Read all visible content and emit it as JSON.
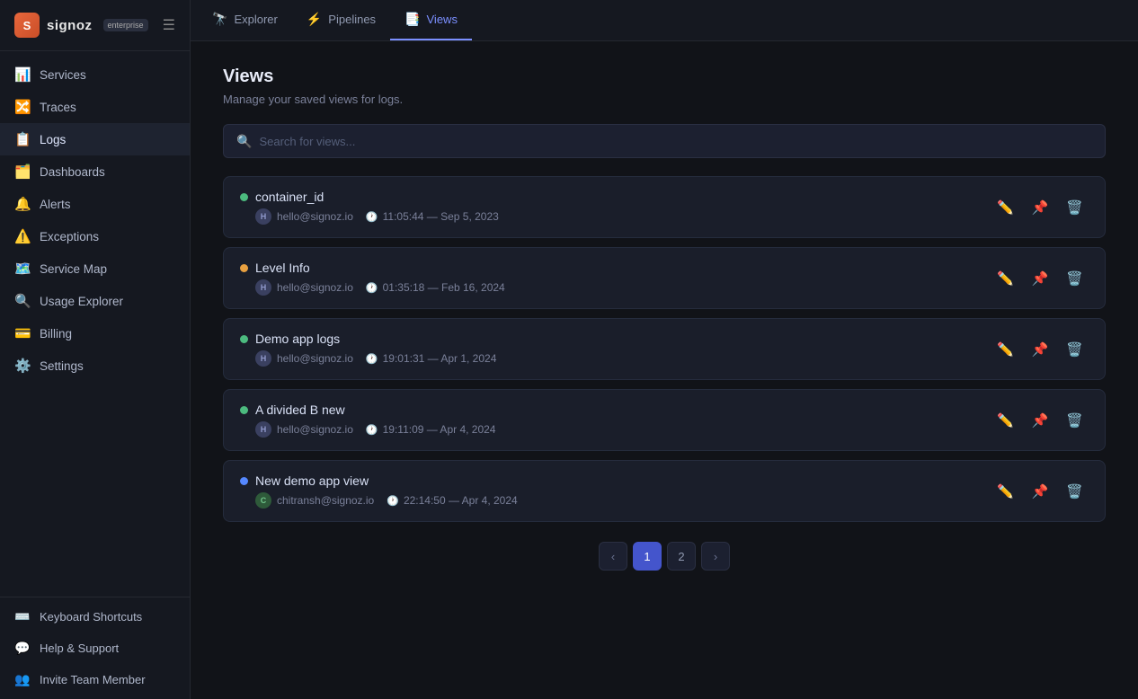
{
  "app": {
    "logo_initials": "S",
    "logo_name": "signoz",
    "logo_badge": "enterprise",
    "hamburger": "≡"
  },
  "sidebar": {
    "nav_items": [
      {
        "id": "services",
        "icon": "📊",
        "label": "Services",
        "active": false
      },
      {
        "id": "traces",
        "icon": "🔀",
        "label": "Traces",
        "active": false
      },
      {
        "id": "logs",
        "icon": "📋",
        "label": "Logs",
        "active": true
      },
      {
        "id": "dashboards",
        "icon": "🗂️",
        "label": "Dashboards",
        "active": false
      },
      {
        "id": "alerts",
        "icon": "🔔",
        "label": "Alerts",
        "active": false
      },
      {
        "id": "exceptions",
        "icon": "⚠️",
        "label": "Exceptions",
        "active": false
      },
      {
        "id": "service-map",
        "icon": "🗺️",
        "label": "Service Map",
        "active": false
      },
      {
        "id": "usage-explorer",
        "icon": "🔍",
        "label": "Usage Explorer",
        "active": false
      },
      {
        "id": "billing",
        "icon": "💳",
        "label": "Billing",
        "active": false
      },
      {
        "id": "settings",
        "icon": "⚙️",
        "label": "Settings",
        "active": false
      }
    ],
    "footer_items": [
      {
        "id": "keyboard-shortcuts",
        "icon": "⌨️",
        "label": "Keyboard Shortcuts"
      },
      {
        "id": "help-support",
        "icon": "💬",
        "label": "Help & Support"
      },
      {
        "id": "invite-team-member",
        "icon": "👥",
        "label": "Invite Team Member"
      }
    ]
  },
  "top_nav": {
    "items": [
      {
        "id": "explorer",
        "icon": "🔭",
        "label": "Explorer",
        "active": false
      },
      {
        "id": "pipelines",
        "icon": "⚡",
        "label": "Pipelines",
        "active": false
      },
      {
        "id": "views",
        "icon": "📑",
        "label": "Views",
        "active": true
      }
    ]
  },
  "main": {
    "title": "Views",
    "subtitle": "Manage your saved views for logs.",
    "search": {
      "placeholder": "Search for views..."
    },
    "views": [
      {
        "id": "container_id",
        "name": "container_id",
        "dot_color": "green",
        "user_initial": "H",
        "user_email": "hello@signoz.io",
        "time": "11:05:44 — Sep 5, 2023"
      },
      {
        "id": "level_info",
        "name": "Level Info",
        "dot_color": "orange",
        "user_initial": "H",
        "user_email": "hello@signoz.io",
        "time": "01:35:18 — Feb 16, 2024"
      },
      {
        "id": "demo_app_logs",
        "name": "Demo app logs",
        "dot_color": "green",
        "user_initial": "H",
        "user_email": "hello@signoz.io",
        "time": "19:01:31 — Apr 1, 2024"
      },
      {
        "id": "a_divided_b_new",
        "name": "A divided B new",
        "dot_color": "green",
        "user_initial": "H",
        "user_email": "hello@signoz.io",
        "time": "19:11:09 — Apr 4, 2024"
      },
      {
        "id": "new_demo_app_view",
        "name": "New demo app view",
        "dot_color": "blue",
        "user_initial": "C",
        "user_email": "chitransh@signoz.io",
        "time": "22:14:50 — Apr 4, 2024",
        "avatar_type": "chitransh"
      }
    ],
    "pagination": {
      "current": 1,
      "total": 2,
      "prev_label": "‹",
      "next_label": "›"
    }
  }
}
